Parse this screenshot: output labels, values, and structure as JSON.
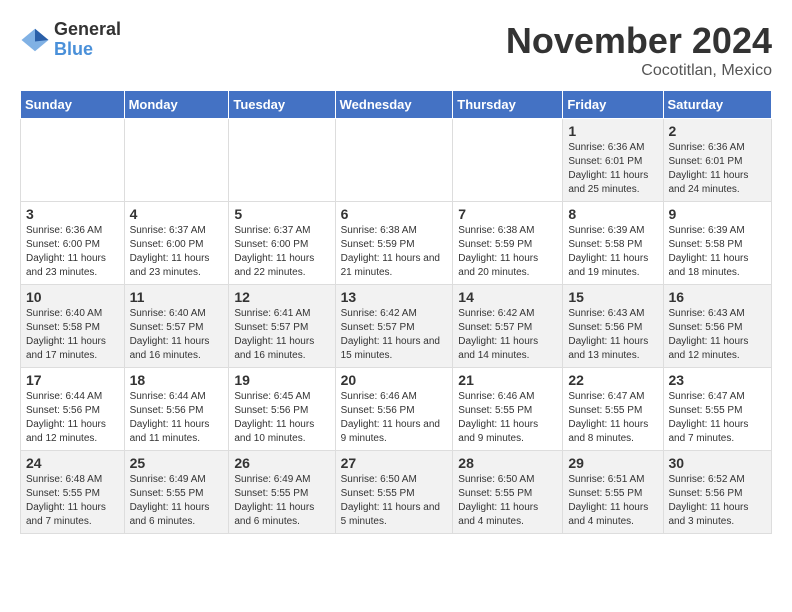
{
  "logo": {
    "general": "General",
    "blue": "Blue"
  },
  "title": "November 2024",
  "subtitle": "Cocotitlan, Mexico",
  "days_of_week": [
    "Sunday",
    "Monday",
    "Tuesday",
    "Wednesday",
    "Thursday",
    "Friday",
    "Saturday"
  ],
  "weeks": [
    [
      {
        "day": "",
        "info": ""
      },
      {
        "day": "",
        "info": ""
      },
      {
        "day": "",
        "info": ""
      },
      {
        "day": "",
        "info": ""
      },
      {
        "day": "",
        "info": ""
      },
      {
        "day": "1",
        "info": "Sunrise: 6:36 AM\nSunset: 6:01 PM\nDaylight: 11 hours and 25 minutes."
      },
      {
        "day": "2",
        "info": "Sunrise: 6:36 AM\nSunset: 6:01 PM\nDaylight: 11 hours and 24 minutes."
      }
    ],
    [
      {
        "day": "3",
        "info": "Sunrise: 6:36 AM\nSunset: 6:00 PM\nDaylight: 11 hours and 23 minutes."
      },
      {
        "day": "4",
        "info": "Sunrise: 6:37 AM\nSunset: 6:00 PM\nDaylight: 11 hours and 23 minutes."
      },
      {
        "day": "5",
        "info": "Sunrise: 6:37 AM\nSunset: 6:00 PM\nDaylight: 11 hours and 22 minutes."
      },
      {
        "day": "6",
        "info": "Sunrise: 6:38 AM\nSunset: 5:59 PM\nDaylight: 11 hours and 21 minutes."
      },
      {
        "day": "7",
        "info": "Sunrise: 6:38 AM\nSunset: 5:59 PM\nDaylight: 11 hours and 20 minutes."
      },
      {
        "day": "8",
        "info": "Sunrise: 6:39 AM\nSunset: 5:58 PM\nDaylight: 11 hours and 19 minutes."
      },
      {
        "day": "9",
        "info": "Sunrise: 6:39 AM\nSunset: 5:58 PM\nDaylight: 11 hours and 18 minutes."
      }
    ],
    [
      {
        "day": "10",
        "info": "Sunrise: 6:40 AM\nSunset: 5:58 PM\nDaylight: 11 hours and 17 minutes."
      },
      {
        "day": "11",
        "info": "Sunrise: 6:40 AM\nSunset: 5:57 PM\nDaylight: 11 hours and 16 minutes."
      },
      {
        "day": "12",
        "info": "Sunrise: 6:41 AM\nSunset: 5:57 PM\nDaylight: 11 hours and 16 minutes."
      },
      {
        "day": "13",
        "info": "Sunrise: 6:42 AM\nSunset: 5:57 PM\nDaylight: 11 hours and 15 minutes."
      },
      {
        "day": "14",
        "info": "Sunrise: 6:42 AM\nSunset: 5:57 PM\nDaylight: 11 hours and 14 minutes."
      },
      {
        "day": "15",
        "info": "Sunrise: 6:43 AM\nSunset: 5:56 PM\nDaylight: 11 hours and 13 minutes."
      },
      {
        "day": "16",
        "info": "Sunrise: 6:43 AM\nSunset: 5:56 PM\nDaylight: 11 hours and 12 minutes."
      }
    ],
    [
      {
        "day": "17",
        "info": "Sunrise: 6:44 AM\nSunset: 5:56 PM\nDaylight: 11 hours and 12 minutes."
      },
      {
        "day": "18",
        "info": "Sunrise: 6:44 AM\nSunset: 5:56 PM\nDaylight: 11 hours and 11 minutes."
      },
      {
        "day": "19",
        "info": "Sunrise: 6:45 AM\nSunset: 5:56 PM\nDaylight: 11 hours and 10 minutes."
      },
      {
        "day": "20",
        "info": "Sunrise: 6:46 AM\nSunset: 5:56 PM\nDaylight: 11 hours and 9 minutes."
      },
      {
        "day": "21",
        "info": "Sunrise: 6:46 AM\nSunset: 5:55 PM\nDaylight: 11 hours and 9 minutes."
      },
      {
        "day": "22",
        "info": "Sunrise: 6:47 AM\nSunset: 5:55 PM\nDaylight: 11 hours and 8 minutes."
      },
      {
        "day": "23",
        "info": "Sunrise: 6:47 AM\nSunset: 5:55 PM\nDaylight: 11 hours and 7 minutes."
      }
    ],
    [
      {
        "day": "24",
        "info": "Sunrise: 6:48 AM\nSunset: 5:55 PM\nDaylight: 11 hours and 7 minutes."
      },
      {
        "day": "25",
        "info": "Sunrise: 6:49 AM\nSunset: 5:55 PM\nDaylight: 11 hours and 6 minutes."
      },
      {
        "day": "26",
        "info": "Sunrise: 6:49 AM\nSunset: 5:55 PM\nDaylight: 11 hours and 6 minutes."
      },
      {
        "day": "27",
        "info": "Sunrise: 6:50 AM\nSunset: 5:55 PM\nDaylight: 11 hours and 5 minutes."
      },
      {
        "day": "28",
        "info": "Sunrise: 6:50 AM\nSunset: 5:55 PM\nDaylight: 11 hours and 4 minutes."
      },
      {
        "day": "29",
        "info": "Sunrise: 6:51 AM\nSunset: 5:55 PM\nDaylight: 11 hours and 4 minutes."
      },
      {
        "day": "30",
        "info": "Sunrise: 6:52 AM\nSunset: 5:56 PM\nDaylight: 11 hours and 3 minutes."
      }
    ]
  ]
}
